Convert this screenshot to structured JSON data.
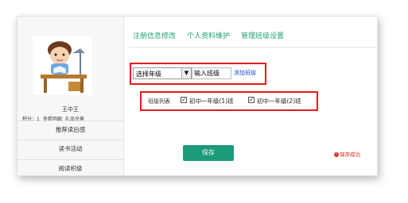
{
  "user": {
    "name": "王中王",
    "points_text": "积分：1",
    "view_detail": "查看明细",
    "gift_exchange": "礼品兑换"
  },
  "sidebar": {
    "items": [
      {
        "label": "推荐读后感"
      },
      {
        "label": "读书活动"
      },
      {
        "label": "阅读积级"
      }
    ]
  },
  "tabs": [
    {
      "label": "注册信息修改"
    },
    {
      "label": "个人资料维护"
    },
    {
      "label": "管理班级设置",
      "active": true
    }
  ],
  "grade_select": {
    "value": "选择年级"
  },
  "class_input": {
    "value": "输入班级"
  },
  "add_class_link": "添加班级",
  "class_list": {
    "label": "班级列表",
    "items": [
      {
        "label": "初中一年级(1)班",
        "checked": true
      },
      {
        "label": "初中一年级(2)班",
        "checked": true
      }
    ]
  },
  "save_button": "保存",
  "save_status": "保存成功",
  "colors": {
    "accent": "#1d9a7a",
    "highlight": "#e51c1c",
    "link": "#1a4ccc"
  }
}
